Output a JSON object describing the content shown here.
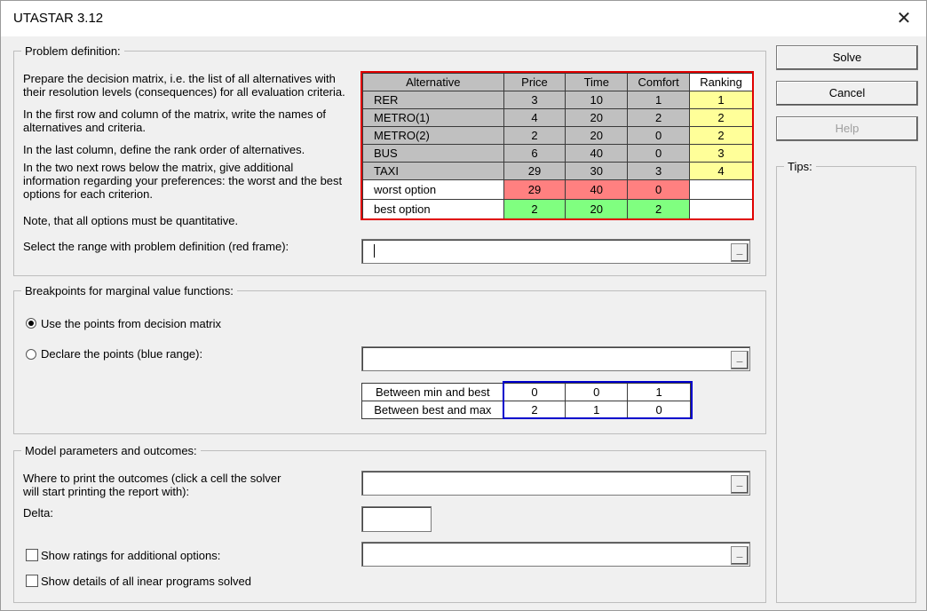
{
  "window": {
    "title": "UTASTAR 3.12",
    "close_symbol": "✕"
  },
  "problem": {
    "legend": "Problem definition:",
    "para1": "Prepare the decision matrix, i.e. the list of all alternatives with their resolution levels (consequences) for all evaluation criteria.",
    "para2": "In the first row and column of the matrix, write the names of alternatives and criteria.",
    "para3": "In the last column, define the rank order of alternatives.",
    "para4": "In the two next rows below the matrix, give additional information regarding your preferences: the worst and the best options for each criterion.",
    "para5": "Note, that all options must be quantitative.",
    "range_label": "Select the range with problem definition (red frame):",
    "ref_btn": "_",
    "matrix": {
      "headers": [
        "Alternative",
        "Price",
        "Time",
        "Comfort",
        "Ranking"
      ],
      "rows": [
        [
          "RER",
          "3",
          "10",
          "1",
          "1"
        ],
        [
          "METRO(1)",
          "4",
          "20",
          "2",
          "2"
        ],
        [
          "METRO(2)",
          "2",
          "20",
          "0",
          "2"
        ],
        [
          "BUS",
          "6",
          "40",
          "0",
          "3"
        ],
        [
          "TAXI",
          "29",
          "30",
          "3",
          "4"
        ]
      ],
      "worst": [
        "worst option",
        "29",
        "40",
        "0",
        ""
      ],
      "best": [
        "best option",
        "2",
        "20",
        "2",
        ""
      ]
    }
  },
  "breakpoints": {
    "legend": "Breakpoints for marginal value functions:",
    "option1": "Use the points from decision matrix",
    "option2": "Declare the points (blue range):",
    "selected": 1,
    "ref_btn": "_",
    "table": [
      [
        "Between min and best",
        "0",
        "0",
        "1"
      ],
      [
        "Between best and max",
        "2",
        "1",
        "0"
      ]
    ]
  },
  "model": {
    "legend": "Model parameters and outcomes:",
    "print_label": "Where to print the outcomes (click a cell the solver will start printing the report with):",
    "delta_label": "Delta:",
    "delta_value": "",
    "show_ratings": "Show ratings for additional options:",
    "show_details": "Show details of all inear programs solved",
    "ref_btn": "_"
  },
  "buttons": {
    "solve": "Solve",
    "cancel": "Cancel",
    "help": "Help"
  },
  "tips": {
    "legend": "Tips:"
  },
  "colors": {
    "matrix_frame": "#e00000",
    "breakpoints_frame": "#0000cc",
    "worst": "#ff8080",
    "best": "#80ff80",
    "ranking": "#ffff99"
  }
}
